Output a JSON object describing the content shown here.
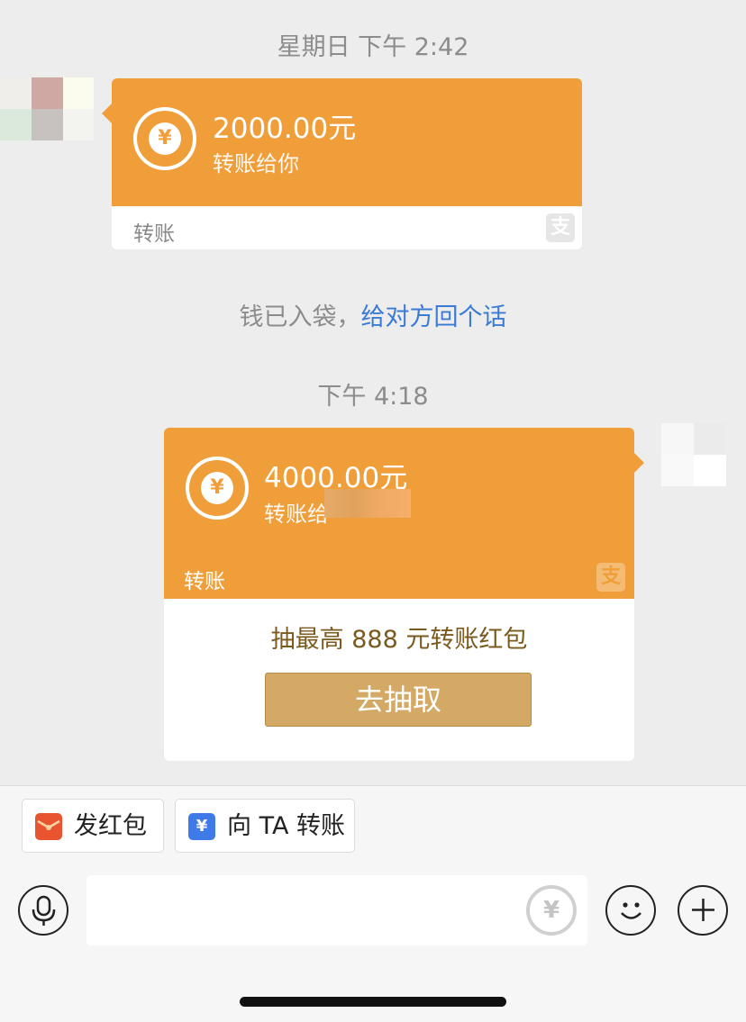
{
  "timestamps": {
    "first": "星期日 下午 2:42",
    "second": "下午 4:18"
  },
  "received_transfer": {
    "amount": "2000.00元",
    "subtitle": "转账给你",
    "footer_label": "转账",
    "brand_icon": "alipay-icon",
    "brand_glyph": "支"
  },
  "system_message": {
    "text": "钱已入袋，",
    "link": "给对方回个话"
  },
  "sent_transfer": {
    "amount": "4000.00元",
    "subtitle": "转账给",
    "footer_label": "转账",
    "brand_icon": "alipay-icon",
    "brand_glyph": "支",
    "promo_text": "抽最高 888 元转账红包",
    "promo_button": "去抽取"
  },
  "quick_actions": [
    {
      "label": "发红包",
      "icon": "red-envelope-icon"
    },
    {
      "label": "向 TA 转账",
      "icon": "transfer-icon"
    }
  ],
  "input_bar": {
    "voice_icon": "microphone-icon",
    "transfer_icon": "yuan-transfer-icon",
    "emoji_icon": "smiley-icon",
    "more_icon": "plus-icon",
    "yuan_glyph": "¥"
  },
  "colors": {
    "transfer_orange": "#f09e3a",
    "link_blue": "#3a7bd5",
    "promo_button": "#d4a865",
    "background": "#ededed"
  }
}
